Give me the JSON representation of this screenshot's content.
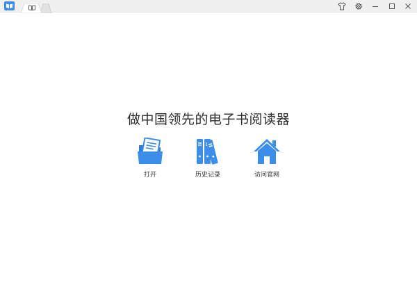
{
  "window": {
    "tab_icon": "book-open-icon",
    "buttons": [
      "shirt-icon",
      "gear-icon",
      "minimize-icon",
      "maximize-icon",
      "close-icon"
    ]
  },
  "main": {
    "slogan": "做中国领先的电子书阅读器",
    "actions": [
      {
        "label": "打开",
        "icon": "folder-icon"
      },
      {
        "label": "历史记录",
        "icon": "books-icon"
      },
      {
        "label": "访问官网",
        "icon": "home-icon"
      }
    ]
  },
  "colors": {
    "accent": "#3d8ee8",
    "titlebar": "#f0f0f0"
  }
}
